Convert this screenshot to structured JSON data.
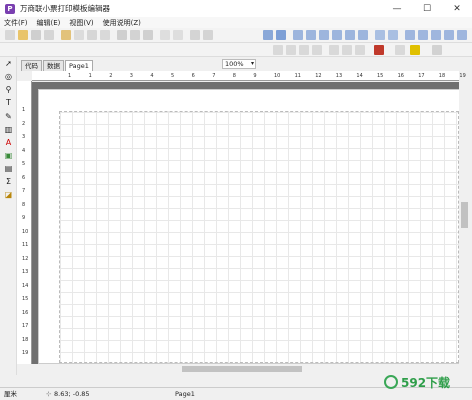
{
  "titlebar": {
    "title": "万商联小票打印模板编辑器",
    "app_icon": "P",
    "min": "—",
    "max": "☐",
    "close": "✕"
  },
  "menubar": {
    "items": [
      "文件(F)",
      "编辑(E)",
      "视图(V)",
      "使用说明(Z)"
    ]
  },
  "toolbar": {
    "zoom": "100%"
  },
  "format_toolbar": {
    "line_width": "1"
  },
  "tabs": [
    {
      "label": "代码"
    },
    {
      "label": "数据"
    },
    {
      "label": "Page1"
    }
  ],
  "ruler": {
    "h_ticks": [
      "1",
      "1",
      "2",
      "3",
      "4",
      "5",
      "6",
      "7",
      "8",
      "9",
      "10",
      "11",
      "12",
      "13",
      "14",
      "15",
      "16",
      "17",
      "18",
      "19"
    ],
    "v_ticks": [
      "1",
      "2",
      "3",
      "4",
      "5",
      "6",
      "7",
      "8",
      "9",
      "10",
      "11",
      "12",
      "13",
      "14",
      "15",
      "16",
      "17",
      "18",
      "19"
    ]
  },
  "statusbar": {
    "unit": "厘米",
    "coords": "8.63; -0.85",
    "page": "Page1"
  },
  "watermark": {
    "text": "592下载"
  }
}
